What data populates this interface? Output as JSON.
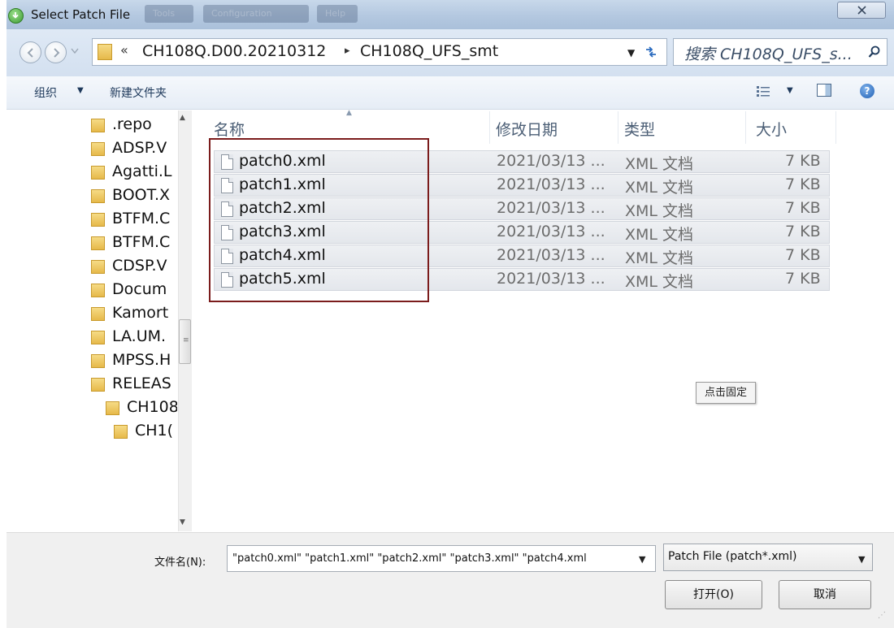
{
  "window": {
    "title": "Select Patch File",
    "background_tabs": [
      "Tools",
      "Configuration",
      "Help"
    ]
  },
  "address": {
    "overflow": "«",
    "crumbs": [
      "CH108Q.D00.20210312",
      "CH108Q_UFS_smt"
    ],
    "separator": "▸"
  },
  "search": {
    "placeholder": "搜索 CH108Q_UFS_s..."
  },
  "toolbar": {
    "organize": "组织",
    "new_folder": "新建文件夹"
  },
  "nav": {
    "items": [
      {
        "label": ".repo"
      },
      {
        "label": "ADSP.V"
      },
      {
        "label": "Agatti.L"
      },
      {
        "label": "BOOT.X"
      },
      {
        "label": "BTFM.C"
      },
      {
        "label": "BTFM.C"
      },
      {
        "label": "CDSP.V"
      },
      {
        "label": "Docum"
      },
      {
        "label": "Kamort"
      },
      {
        "label": "LA.UM."
      },
      {
        "label": "MPSS.H"
      },
      {
        "label": "RELEAS"
      },
      {
        "label": "CH108"
      },
      {
        "label": "CH1("
      }
    ]
  },
  "columns": {
    "name": "名称",
    "date": "修改日期",
    "type": "类型",
    "size": "大小"
  },
  "files": [
    {
      "name": "patch0.xml",
      "date": "2021/03/13 ...",
      "type": "XML 文档",
      "size": "7 KB"
    },
    {
      "name": "patch1.xml",
      "date": "2021/03/13 ...",
      "type": "XML 文档",
      "size": "7 KB"
    },
    {
      "name": "patch2.xml",
      "date": "2021/03/13 ...",
      "type": "XML 文档",
      "size": "7 KB"
    },
    {
      "name": "patch3.xml",
      "date": "2021/03/13 ...",
      "type": "XML 文档",
      "size": "7 KB"
    },
    {
      "name": "patch4.xml",
      "date": "2021/03/13 ...",
      "type": "XML 文档",
      "size": "7 KB"
    },
    {
      "name": "patch5.xml",
      "date": "2021/03/13 ...",
      "type": "XML 文档",
      "size": "7 KB"
    }
  ],
  "pin_button": "点击固定",
  "filename": {
    "label": "文件名(N):",
    "value": "\"patch0.xml\" \"patch1.xml\" \"patch2.xml\" \"patch3.xml\" \"patch4.xml"
  },
  "filetype": {
    "selected": "Patch File (patch*.xml)"
  },
  "buttons": {
    "open": "打开(O)",
    "cancel": "取消"
  },
  "colors": {
    "highlight_border": "#7b1c1c",
    "folder": "#e6b94a",
    "titlebar": "#b4c8e0"
  }
}
